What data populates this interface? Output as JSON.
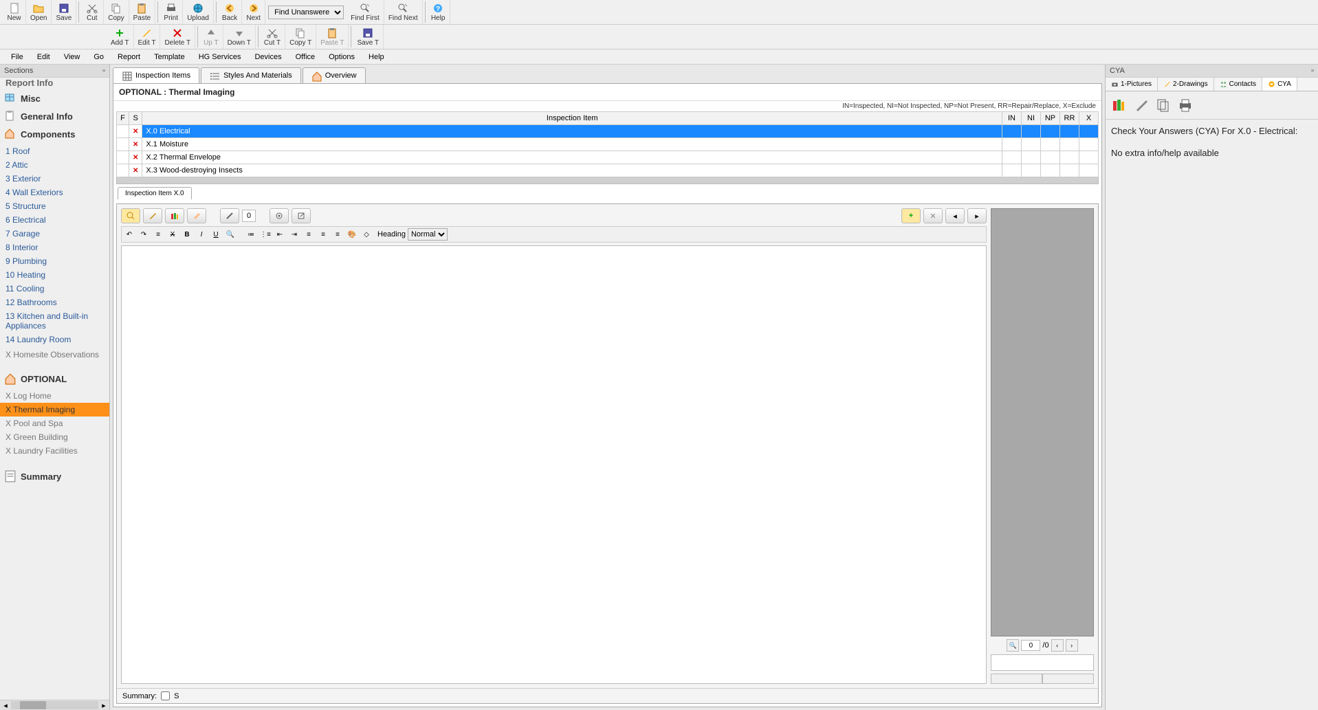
{
  "toolbar1": {
    "buttons": [
      {
        "name": "new-button",
        "label": "New",
        "icon": "file"
      },
      {
        "name": "open-button",
        "label": "Open",
        "icon": "folder"
      },
      {
        "name": "save-button",
        "label": "Save",
        "icon": "disk"
      },
      "sep",
      {
        "name": "cut-button",
        "label": "Cut",
        "icon": "scissors"
      },
      {
        "name": "copy-button",
        "label": "Copy",
        "icon": "copy"
      },
      {
        "name": "paste-button",
        "label": "Paste",
        "icon": "paste"
      },
      "sep",
      {
        "name": "print-button",
        "label": "Print",
        "icon": "printer"
      },
      {
        "name": "upload-button",
        "label": "Upload",
        "icon": "globe"
      },
      "sep",
      {
        "name": "back-button",
        "label": "Back",
        "icon": "arrow-left"
      },
      {
        "name": "next-button",
        "label": "Next",
        "icon": "arrow-right"
      },
      "find",
      {
        "name": "find-first-button",
        "label": "Find First",
        "icon": "find"
      },
      {
        "name": "find-next-button",
        "label": "Find Next",
        "icon": "find"
      },
      "sep",
      {
        "name": "help-button",
        "label": "Help",
        "icon": "help"
      }
    ],
    "find_label": "Find Unanswered"
  },
  "toolbar2": {
    "buttons": [
      {
        "name": "add-t-button",
        "label": "Add T",
        "icon": "plus"
      },
      {
        "name": "edit-t-button",
        "label": "Edit T",
        "icon": "pencil"
      },
      {
        "name": "delete-t-button",
        "label": "Delete T",
        "icon": "delete"
      },
      "sep",
      {
        "name": "up-t-button",
        "label": "Up T",
        "icon": "up",
        "disabled": true
      },
      {
        "name": "down-t-button",
        "label": "Down T",
        "icon": "down"
      },
      "sep",
      {
        "name": "cut-t-button",
        "label": "Cut T",
        "icon": "scissors"
      },
      {
        "name": "copy-t-button",
        "label": "Copy T",
        "icon": "copy"
      },
      {
        "name": "paste-t-button",
        "label": "Paste T",
        "icon": "paste",
        "disabled": true
      },
      "sep",
      {
        "name": "save-t-button",
        "label": "Save T",
        "icon": "disk"
      }
    ]
  },
  "menubar": [
    "File",
    "Edit",
    "View",
    "Go",
    "Report",
    "Template",
    "HG Services",
    "Devices",
    "Office",
    "Options",
    "Help"
  ],
  "sidebar": {
    "header": "Sections",
    "report_info_cut": "Report Info",
    "groups": [
      {
        "name": "group-misc",
        "label": "Misc",
        "icon": "table"
      },
      {
        "name": "group-general-info",
        "label": "General Info",
        "icon": "clipboard"
      },
      {
        "name": "group-components",
        "label": "Components",
        "icon": "house"
      }
    ],
    "components": [
      "1 Roof",
      "2 Attic",
      "3 Exterior",
      "4 Wall Exteriors",
      "5 Structure",
      "6 Electrical",
      "7 Garage",
      "8 Interior",
      "9 Plumbing",
      "10 Heating",
      "11 Cooling",
      "12 Bathrooms",
      "13 Kitchen and Built-in Appliances",
      "14 Laundry Room"
    ],
    "components_gray": "X Homesite Observations",
    "optional_header": {
      "name": "group-optional",
      "label": "OPTIONAL",
      "icon": "house"
    },
    "optional_items": [
      {
        "label": "X Log Home",
        "state": "gray"
      },
      {
        "label": "X Thermal Imaging",
        "state": "selected"
      },
      {
        "label": "X Pool and Spa",
        "state": "gray"
      },
      {
        "label": "X Green Building",
        "state": "gray"
      },
      {
        "label": "X Laundry Facilities",
        "state": "gray"
      }
    ],
    "summary": {
      "name": "group-summary",
      "label": "Summary",
      "icon": "sheet"
    }
  },
  "tabs": [
    {
      "name": "tab-inspection-items",
      "label": "Inspection Items",
      "icon": "grid",
      "active": true
    },
    {
      "name": "tab-styles-materials",
      "label": "Styles And Materials",
      "icon": "list",
      "active": false
    },
    {
      "name": "tab-overview",
      "label": "Overview",
      "icon": "house",
      "active": false
    }
  ],
  "section": {
    "title": "OPTIONAL : Thermal Imaging",
    "legend": "IN=Inspected, NI=Not Inspected, NP=Not Present, RR=Repair/Replace, X=Exclude",
    "columns": [
      "F",
      "S",
      "Inspection Item",
      "IN",
      "NI",
      "NP",
      "RR",
      "X"
    ],
    "rows": [
      {
        "f": "",
        "s": "x",
        "label": "X.0 Electrical",
        "selected": true
      },
      {
        "f": "",
        "s": "x",
        "label": "X.1 Moisture"
      },
      {
        "f": "",
        "s": "x",
        "label": "X.2 Thermal Envelope"
      },
      {
        "f": "",
        "s": "x",
        "label": "X.3 Wood-destroying Insects"
      }
    ]
  },
  "editor": {
    "tab_label": "Inspection Item X.0",
    "count": "0",
    "heading_label": "Heading",
    "format_value": "Normal",
    "summary_label": "Summary:",
    "s_label": "S",
    "pager_current": "0",
    "pager_total": "/0"
  },
  "cya": {
    "header": "CYA",
    "tabs": [
      {
        "name": "cya-tab-pictures",
        "label": "1-Pictures",
        "icon": "camera"
      },
      {
        "name": "cya-tab-drawings",
        "label": "2-Drawings",
        "icon": "pencil"
      },
      {
        "name": "cya-tab-contacts",
        "label": "Contacts",
        "icon": "people"
      },
      {
        "name": "cya-tab-cya",
        "label": "CYA",
        "icon": "cya",
        "active": true
      }
    ],
    "title": "Check Your Answers (CYA) For X.0 - Electrical:",
    "body": "No extra info/help available"
  }
}
